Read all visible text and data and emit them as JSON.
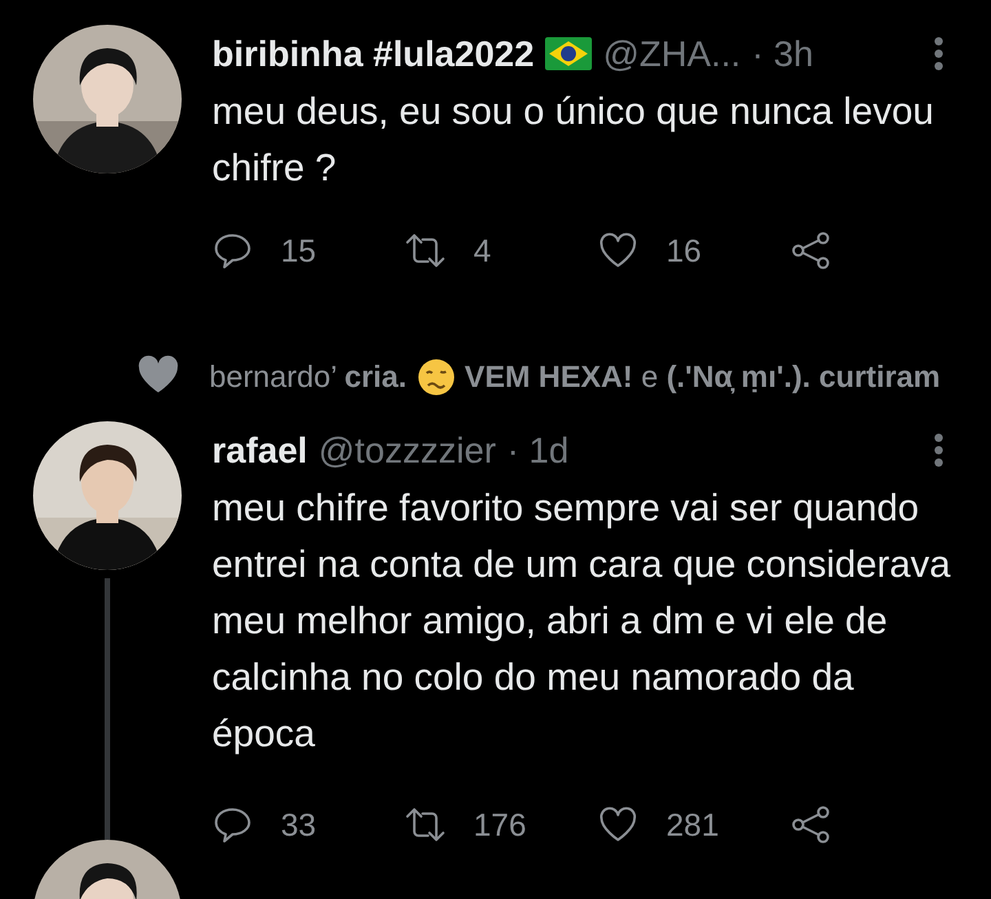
{
  "tweets": [
    {
      "name": "biribinha #lula2022",
      "handle": "@ZHA...",
      "time": "· 3h",
      "text": "meu deus, eu sou o único que nunca levou chifre ?",
      "flag": true,
      "thread": false,
      "stats": {
        "replies": "15",
        "retweets": "4",
        "likes": "16"
      }
    },
    {
      "name": "rafael",
      "handle": "@tozzzzier",
      "time": "· 1d",
      "text": "meu chifre favorito sempre vai ser quando entrei na conta de um cara que considerava meu melhor amigo, abri a dm e vi ele de calcinha no colo do meu namorado da época",
      "flag": false,
      "thread": true,
      "stats": {
        "replies": "33",
        "retweets": "176",
        "likes": "281"
      }
    }
  ],
  "liked_by": {
    "before_emoji": "bernardo’ **cria.**",
    "after_emoji": "**VEM HEXA!** e **(.'Nα̦ ṃı'.).** **curtiram**"
  }
}
